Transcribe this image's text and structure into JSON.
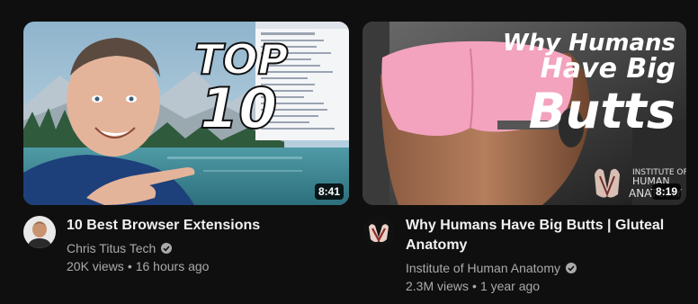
{
  "videos": [
    {
      "title": "10 Best Browser Extensions",
      "duration": "8:41",
      "channel": "Chris Titus Tech",
      "views": "20K views",
      "age": "16 hours ago",
      "thumbnail_text": [
        "TOP",
        "10"
      ],
      "verified": true
    },
    {
      "title": "Why Humans Have Big Butts | Gluteal Anatomy",
      "duration": "8:19",
      "channel": "Institute of Human Anatomy",
      "views": "2.3M views",
      "age": "1 year ago",
      "thumbnail_text": [
        "Why Humans",
        "Have Big",
        "Butts"
      ],
      "watermark": [
        "INSTITUTE OF",
        "HUMAN",
        "ANATOMY"
      ],
      "verified": true
    }
  ],
  "separator": "•",
  "colors": {
    "background": "#0f0f0f",
    "title": "#f1f1f1",
    "secondary": "#aaaaaa",
    "sky": "#a9c7da",
    "shirt": "#1d3f7a",
    "shorts": "#f3a3bd"
  },
  "icons": {
    "verified": "check-circle-icon"
  }
}
